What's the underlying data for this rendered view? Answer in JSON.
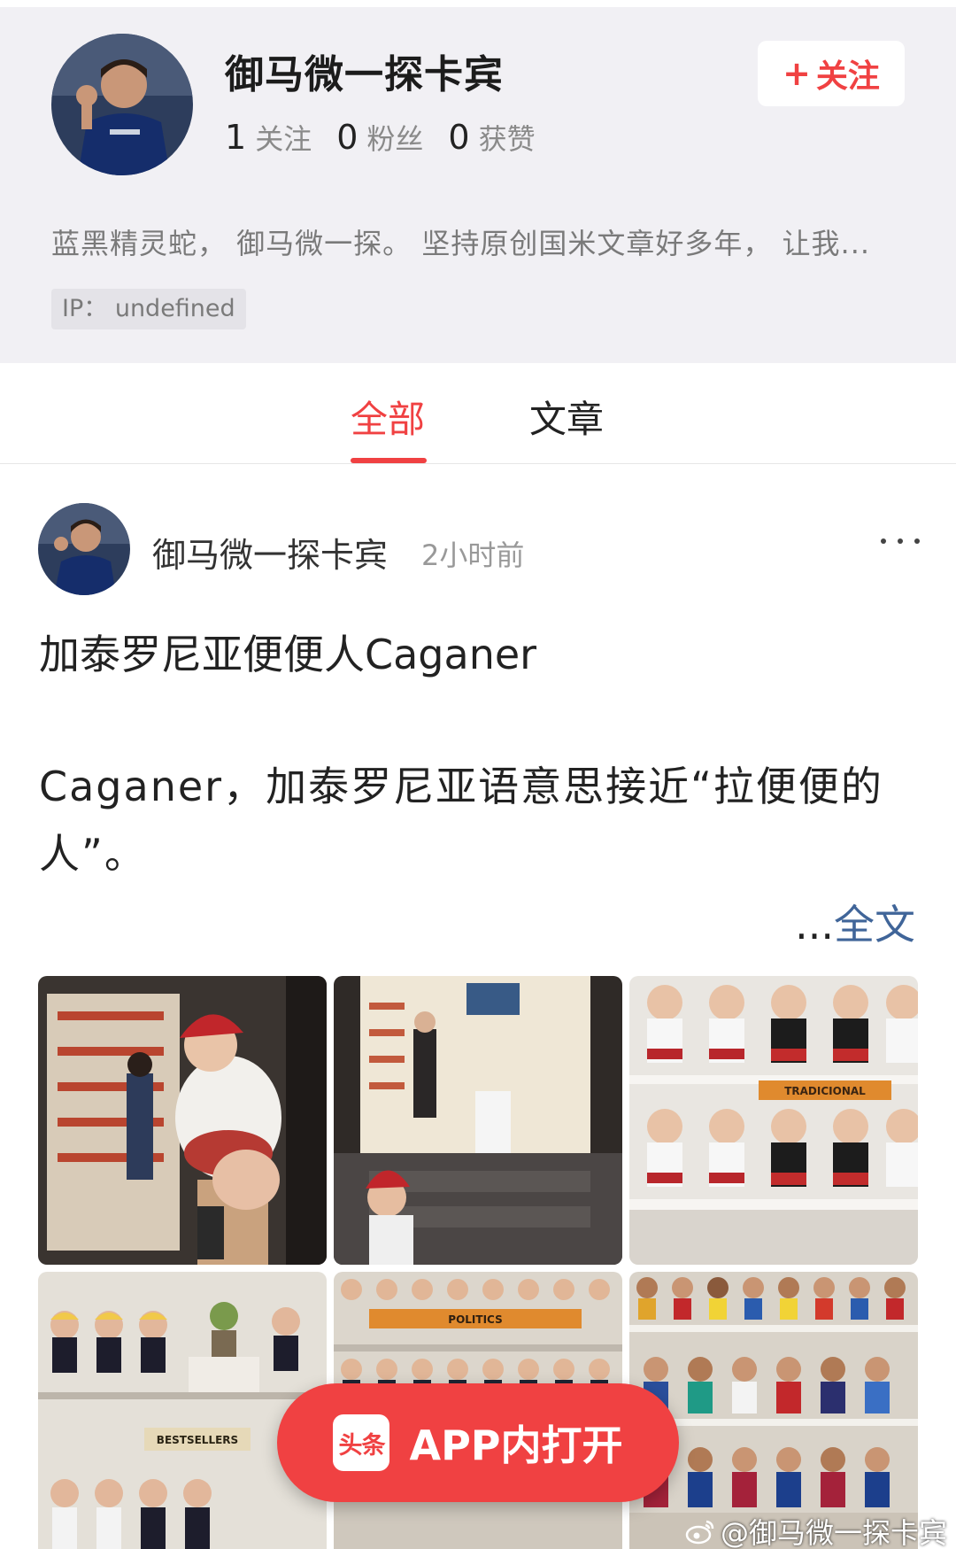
{
  "profile": {
    "name": "御马微一探卡宾",
    "follow_button": "关注",
    "stats": [
      {
        "num": "1",
        "label": "关注"
      },
      {
        "num": "0",
        "label": "粉丝"
      },
      {
        "num": "0",
        "label": "获赞"
      }
    ],
    "bio": "蓝黑精灵蛇，  御马微一探。 坚持原创国米文章好多年，  让我...",
    "ip": "IP：  undefined"
  },
  "tabs": [
    {
      "label": "全部",
      "active": true
    },
    {
      "label": "文章",
      "active": false
    }
  ],
  "post": {
    "author": "御马微一探卡宾",
    "time": "2小时前",
    "title": "加泰罗尼亚便便人Caganer",
    "body": "Caganer，加泰罗尼亚语意思接近“拉便便的人”。",
    "read_more_prefix": "...",
    "read_more_link": "全文",
    "images": [
      {
        "icon": "photo-shop-doorway"
      },
      {
        "icon": "photo-shop-entrance"
      },
      {
        "icon": "photo-shelf-tradicional",
        "sign": "TRADICIONAL"
      },
      {
        "icon": "photo-shelf-bestsellers",
        "sign": "BESTSELLERS"
      },
      {
        "icon": "photo-shelf-politics",
        "sign": "POLITICS"
      },
      {
        "icon": "photo-shelf-football"
      }
    ]
  },
  "open_app": {
    "logo": "头条",
    "label": "APP内打开"
  },
  "watermark": "@御马微一探卡宾",
  "colors": {
    "accent": "#f04142",
    "link": "#406599",
    "header_bg": "#f1f0f4"
  }
}
